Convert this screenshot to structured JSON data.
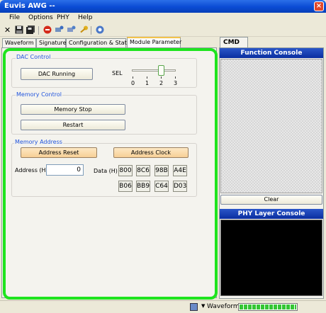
{
  "window": {
    "title": "Euvis AWG --",
    "close_glyph": "×"
  },
  "menu": [
    "File",
    "Options",
    "PHY",
    "Help"
  ],
  "toolbar": {
    "icons": [
      "close-icon",
      "save-icon",
      "save-all-icon",
      "stop-icon",
      "connect-icon",
      "disconnect-icon",
      "key-icon",
      "settings-icon"
    ]
  },
  "tabs": [
    "Waveform",
    "Signature",
    "Configuration & Status",
    "Module Parameter"
  ],
  "active_tab": "Module Parameter",
  "dac_control": {
    "title": "DAC Control",
    "running_button": "DAC Running",
    "sel_label": "SEL",
    "sel_ticks": [
      "0",
      "1",
      "2",
      "3"
    ],
    "sel_value": 2
  },
  "memory_control": {
    "title": "Memory Control",
    "stop_button": "Memory Stop",
    "restart_button": "Restart"
  },
  "memory_address": {
    "title": "Memory Address",
    "reset_button": "Address Reset",
    "clock_button": "Address Clock",
    "address_label": "Address (H)",
    "address_value": "0",
    "data_label": "Data (H)",
    "data_row1": [
      "800",
      "8C6",
      "98B",
      "A4E"
    ],
    "data_row2": [
      "B06",
      "BB9",
      "C64",
      "D03"
    ]
  },
  "right_panel": {
    "cmd_tab": "CMD",
    "function_console": "Function Console",
    "clear_button": "Clear",
    "phy_console": "PHY Layer Console"
  },
  "status": {
    "mode": "Waveform",
    "progress": 1.0
  },
  "colors": {
    "highlight_frame": "#1ee41e",
    "console_header": "#0a2ea0",
    "group_title": "#2255dd"
  }
}
